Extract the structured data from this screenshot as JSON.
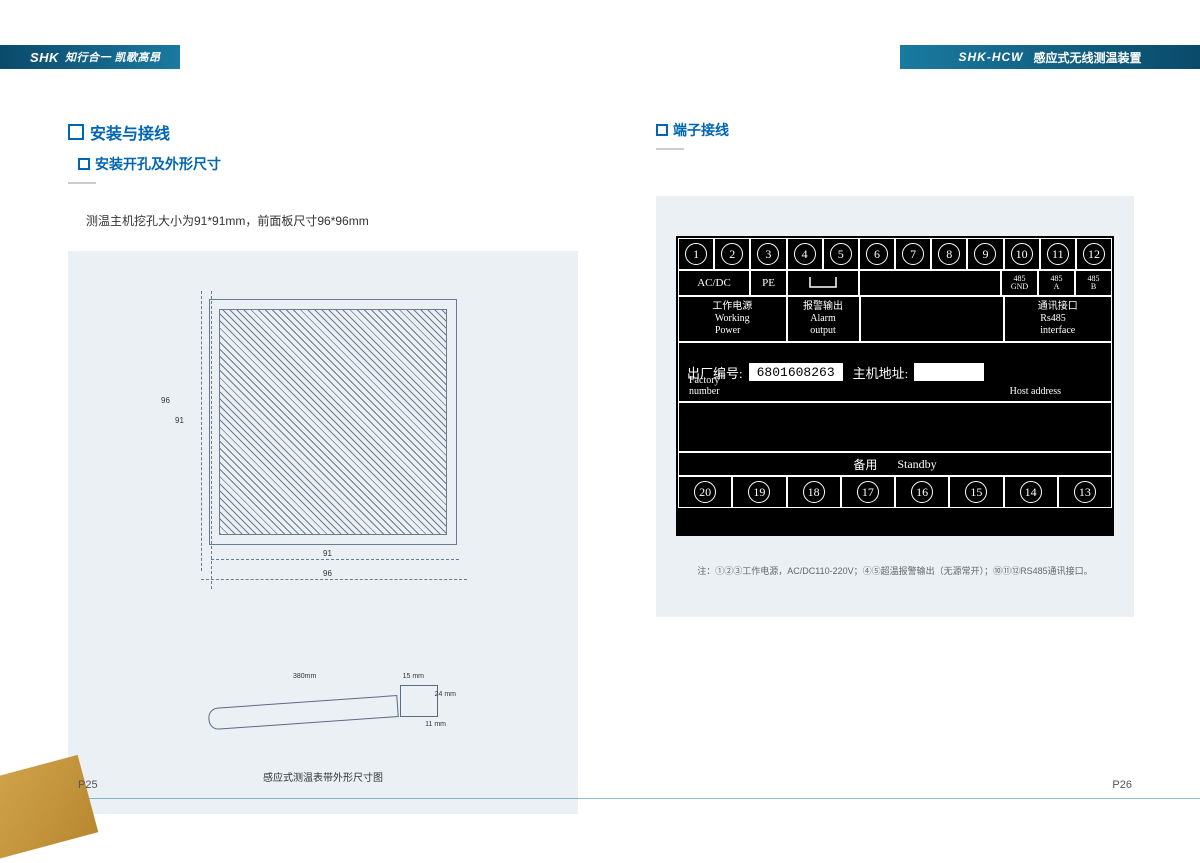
{
  "header": {
    "brand": "SHK",
    "slogan": "知行合一 凯歌高昂",
    "model": "SHK-HCW",
    "product": "感应式无线测温装置"
  },
  "left": {
    "title": "安装与接线",
    "subtitle": "安装开孔及外形尺寸",
    "desc": "测温主机挖孔大小为91*91mm，前面板尺寸96*96mm",
    "dim_96_v": "96",
    "dim_91_v": "91",
    "dim_91_h": "91",
    "dim_96_h": "96",
    "belt_380": "380mm",
    "belt_15": "15 mm",
    "belt_11": "11 mm",
    "belt_24": "24 mm",
    "belt_caption": "感应式测温表带外形尺寸图"
  },
  "right": {
    "subtitle": "端子接线",
    "top_pins": [
      "1",
      "2",
      "3",
      "4",
      "5",
      "6",
      "7",
      "8",
      "9",
      "10",
      "11",
      "12"
    ],
    "row2": {
      "acdc": "AC/DC",
      "pe": "PE",
      "gnd": "485\nGND",
      "a": "485\nA",
      "b": "485\nB"
    },
    "row3": {
      "power_cn": "工作电源",
      "power_en": "Working\nPower",
      "alarm_cn": "报警输出",
      "alarm_en": "Alarm\noutput",
      "comm_cn": "通讯接口",
      "comm_en": "Rs485\ninterface"
    },
    "mid": {
      "sn_lbl": "出厂编号:",
      "sn": "6801608263",
      "addr_lbl": "主机地址:",
      "sn_en": "Factory\nnumber",
      "addr_en": "Host address"
    },
    "standby_cn": "备用",
    "standby_en": "Standby",
    "bottom_pins": [
      "20",
      "19",
      "18",
      "17",
      "16",
      "15",
      "14",
      "13"
    ],
    "note": "注：①②③工作电源，AC/DC110-220V；④⑤超温报警输出（无源常开）；⑩⑪⑫RS485通讯接口。"
  },
  "pages": {
    "left": "P25",
    "right": "P26"
  }
}
